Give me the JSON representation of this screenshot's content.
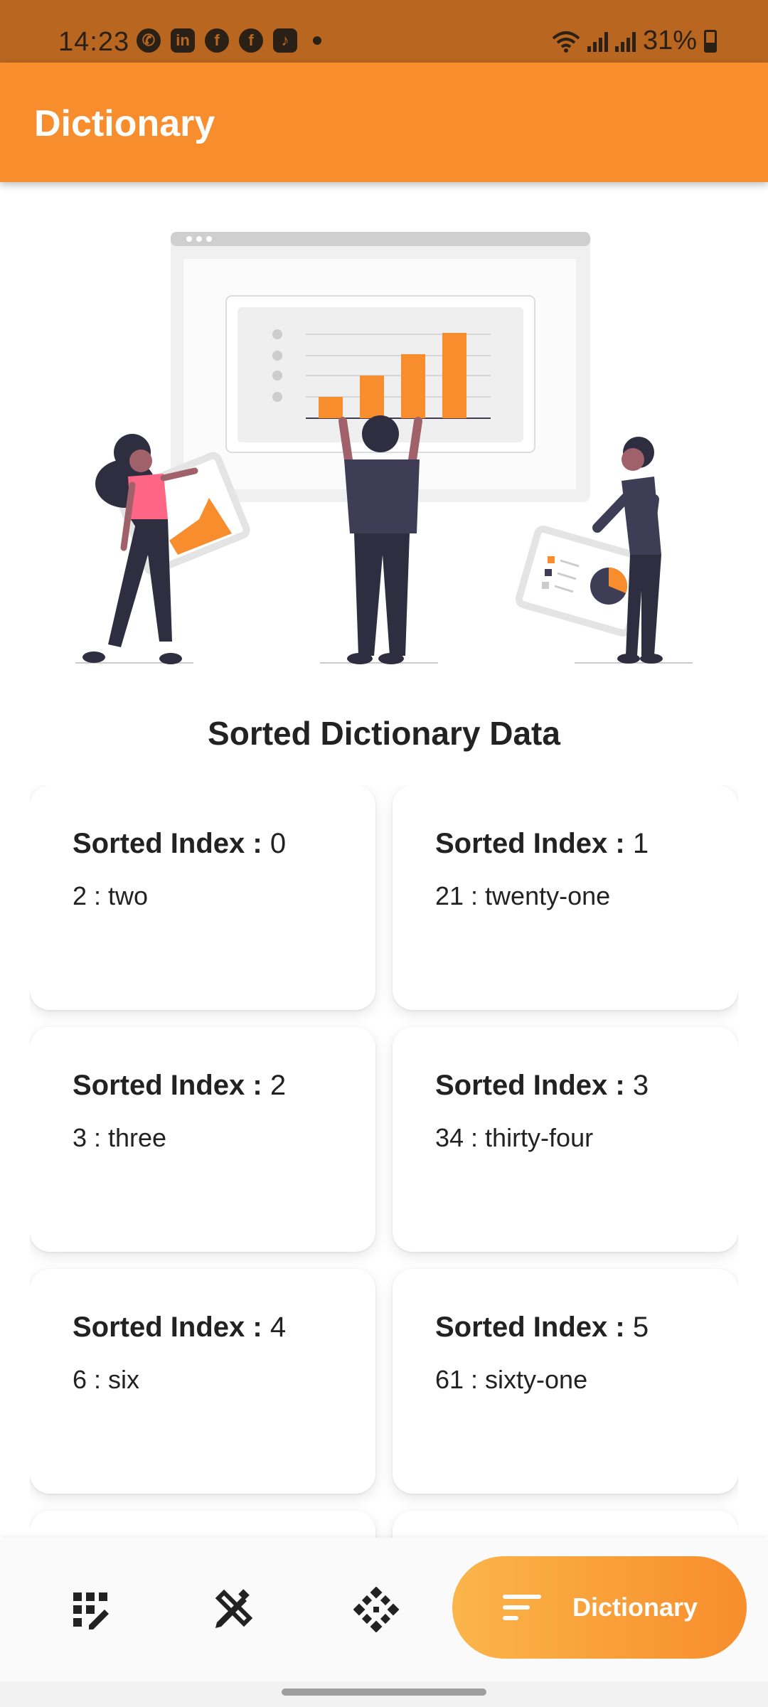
{
  "status_bar": {
    "time": "14:23",
    "battery": "31%",
    "notification_icons": [
      "whatsapp-icon",
      "linkedin-icon",
      "facebook-icon",
      "facebook-icon",
      "tiktok-icon"
    ]
  },
  "app_bar": {
    "title": "Dictionary"
  },
  "section": {
    "title": "Sorted Dictionary Data"
  },
  "cards": [
    {
      "label": "Sorted Index : ",
      "index": "0",
      "value": "2 : two"
    },
    {
      "label": "Sorted Index : ",
      "index": "1",
      "value": "21 : twenty-one"
    },
    {
      "label": "Sorted Index : ",
      "index": "2",
      "value": "3 : three"
    },
    {
      "label": "Sorted Index : ",
      "index": "3",
      "value": "34 : thirty-four"
    },
    {
      "label": "Sorted Index : ",
      "index": "4",
      "value": "6 : six"
    },
    {
      "label": "Sorted Index : ",
      "index": "5",
      "value": "61 : sixty-one"
    }
  ],
  "bottom_nav": {
    "items": [
      {
        "icon": "grid-edit-icon"
      },
      {
        "icon": "design-tools-icon"
      },
      {
        "icon": "diamond-dots-icon"
      }
    ],
    "active": {
      "icon": "sort-icon",
      "label": "Dictionary"
    }
  },
  "colors": {
    "status_bar": "#b86620",
    "app_bar": "#f78d2c",
    "accent": "#f78d2c",
    "nav_gradient_start": "#fbb54a"
  }
}
